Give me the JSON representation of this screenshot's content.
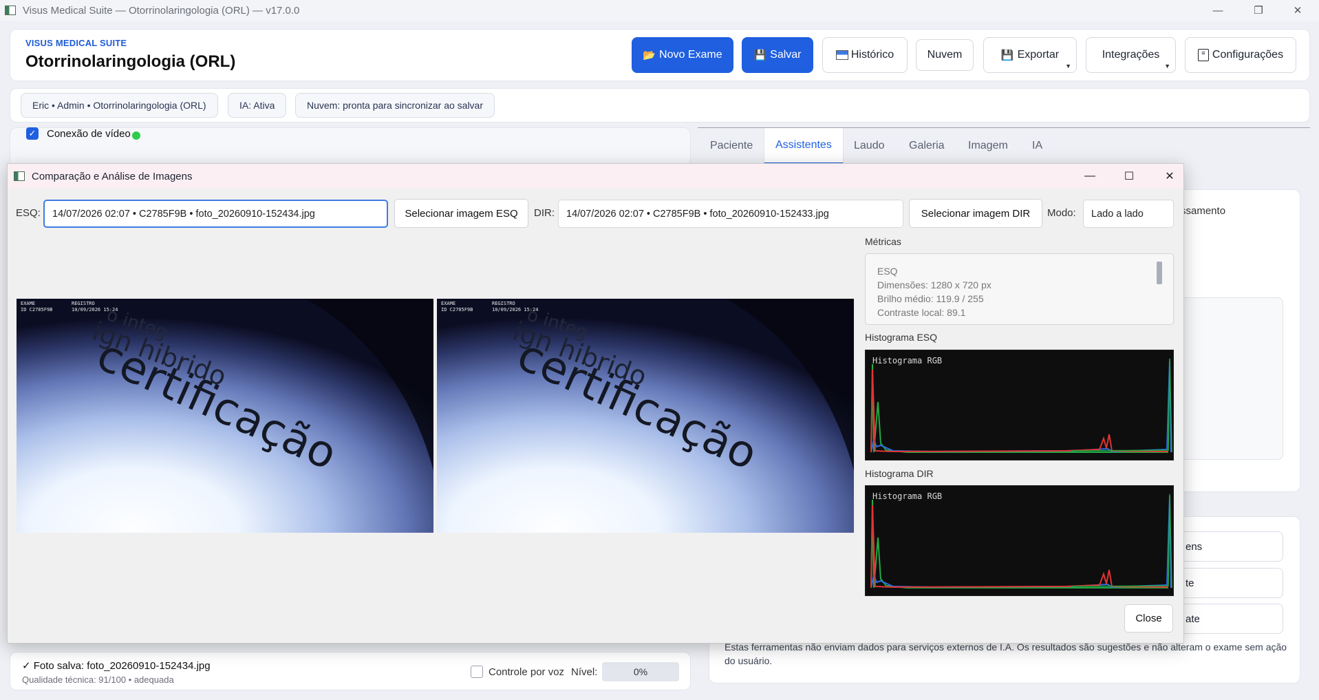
{
  "window": {
    "title": "Visus Medical Suite — Otorrinolaringologia (ORL) — v17.0.0",
    "minimize_icon": "minimize-icon",
    "restore_icon": "restore-icon",
    "close_icon": "close-icon"
  },
  "header": {
    "brand": "VISUS MEDICAL SUITE",
    "specialty": "Otorrinolaringologia (ORL)",
    "buttons": {
      "new_exam": "Novo Exame",
      "save": "Salvar",
      "history": "Histórico",
      "cloud": "Nuvem",
      "export": "Exportar",
      "integrations": "Integrações",
      "settings": "Configurações"
    },
    "accent": "#1f5fe0"
  },
  "status": {
    "user_chip": "Eric • Admin • Otorrinolaringologia (ORL)",
    "ai_chip": "IA: Ativa",
    "cloud_chip": "Nuvem: pronta para sincronizar ao salvar"
  },
  "video": {
    "label": "Conexão de vídeo",
    "checked": true,
    "indicator_color": "#2ecc4a"
  },
  "tabs": [
    "Paciente",
    "Assistentes",
    "Laudo",
    "Galeria",
    "Imagem",
    "IA"
  ],
  "active_tab": "Assistentes",
  "right_panel": {
    "peek_text": "ssamento",
    "peek_buttons": [
      "ens",
      "te",
      "ate"
    ],
    "disclaimer": "Estas ferramentas não enviam dados para serviços externos de I.A. Os resultados são sugestões e não alteram o exame sem ação do usuário."
  },
  "bottom": {
    "saved": "✓ Foto salva: foto_20260910-152434.jpg",
    "quality": "Qualidade técnica: 91/100 • adequada",
    "voice_label": "Controle por voz",
    "level_label": "Nível:",
    "level_value": "0%"
  },
  "dialog": {
    "title": "Comparação e Análise de Imagens",
    "left_label": "ESQ:",
    "left_value": "14/07/2026 02:07 • C2785F9B • foto_20260910-152434.jpg",
    "select_left": "Selecionar imagem ESQ",
    "right_label": "DIR:",
    "right_value": "14/07/2026 02:07 • C2785F9B • foto_20260910-152433.jpg",
    "select_right": "Selecionar imagem DIR",
    "mode_label": "Modo:",
    "mode_value": "Lado a lado",
    "image_overlay": {
      "exam_label": "EXAME",
      "exam_id": "ID C2785F9B",
      "reg_label": "REGISTRO",
      "reg_date": "10/09/2026 15:24"
    },
    "image_text": {
      "line1": "certificação",
      "line2": "ign hibrido",
      "line3": "o integ"
    },
    "metrics_label": "Métricas",
    "metrics": {
      "side": "ESQ",
      "dimensions": "Dimensões: 1280 x 720 px",
      "brightness": "Brilho médio: 119.9 / 255",
      "contrast": "Contraste local: 89.1"
    },
    "hist_left_label": "Histograma ESQ",
    "hist_right_label": "Histograma DIR",
    "hist_title": "Histograma RGB",
    "close": "Close"
  }
}
